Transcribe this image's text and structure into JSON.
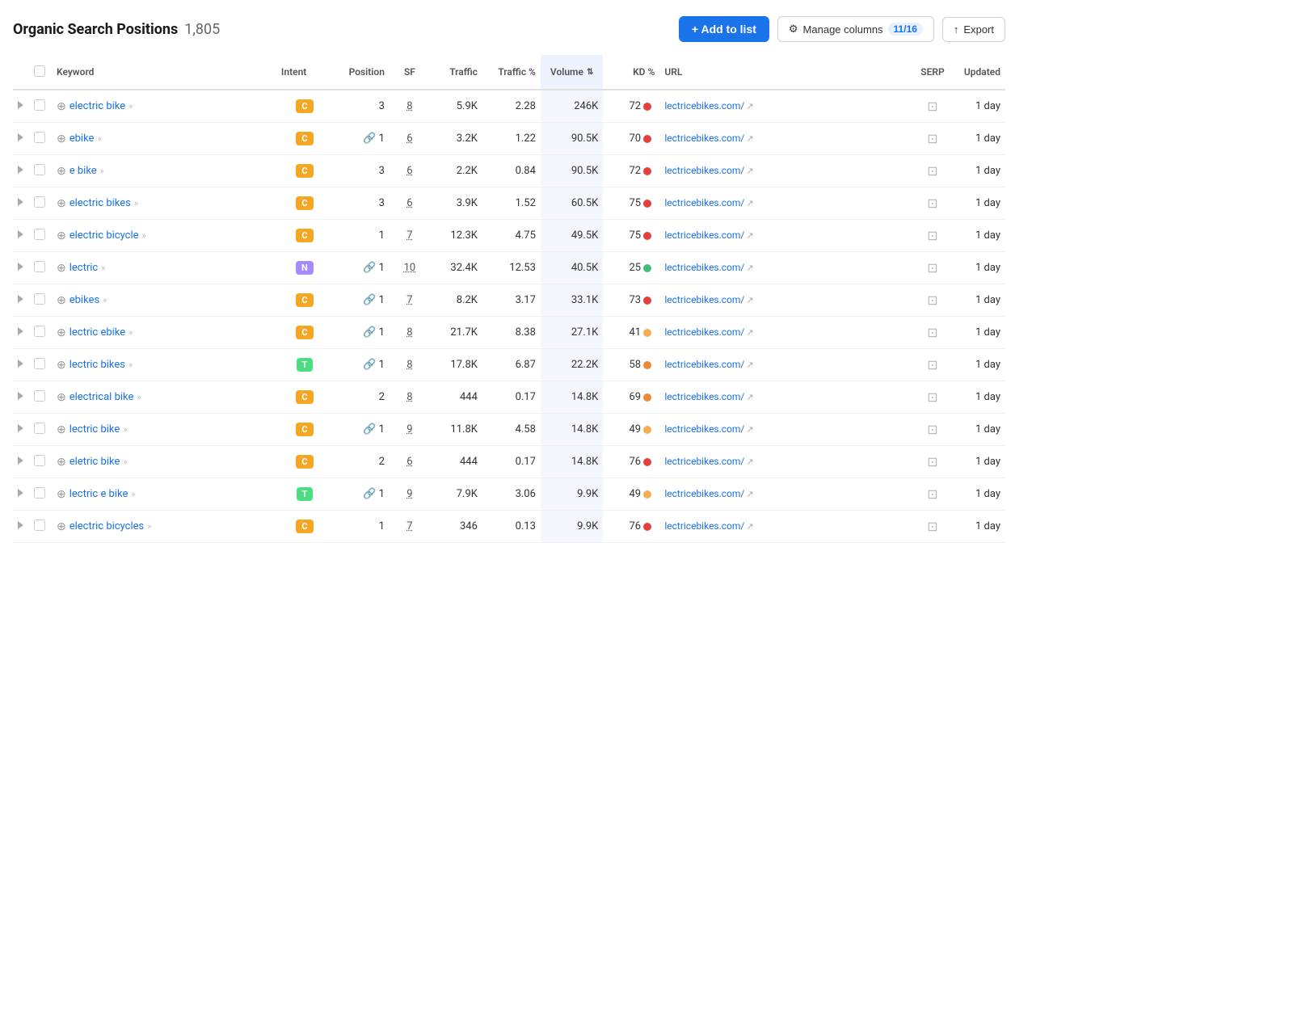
{
  "header": {
    "title": "Organic Search Positions",
    "count": "1,805",
    "add_button": "+ Add to list",
    "manage_columns_button": "Manage columns",
    "manage_columns_count": "11/16",
    "export_button": "Export"
  },
  "table": {
    "columns": [
      {
        "id": "expand",
        "label": ""
      },
      {
        "id": "check",
        "label": ""
      },
      {
        "id": "keyword",
        "label": "Keyword"
      },
      {
        "id": "intent",
        "label": "Intent"
      },
      {
        "id": "position",
        "label": "Position"
      },
      {
        "id": "sf",
        "label": "SF"
      },
      {
        "id": "traffic",
        "label": "Traffic"
      },
      {
        "id": "traffic_pct",
        "label": "Traffic %"
      },
      {
        "id": "volume",
        "label": "Volume"
      },
      {
        "id": "kd",
        "label": "KD %"
      },
      {
        "id": "url",
        "label": "URL"
      },
      {
        "id": "serp",
        "label": "SERP"
      },
      {
        "id": "updated",
        "label": "Updated"
      }
    ],
    "rows": [
      {
        "keyword": "electric bike",
        "intent": "C",
        "intent_type": "c",
        "has_link": false,
        "position": "3",
        "sf": "8",
        "traffic": "5.9K",
        "traffic_pct": "2.28",
        "volume": "246K",
        "kd": "72",
        "kd_color": "#e53e3e",
        "url": "lectricebikes.com/",
        "updated": "1 day"
      },
      {
        "keyword": "ebike",
        "intent": "C",
        "intent_type": "c",
        "has_link": true,
        "position": "1",
        "sf": "6",
        "traffic": "3.2K",
        "traffic_pct": "1.22",
        "volume": "90.5K",
        "kd": "70",
        "kd_color": "#e53e3e",
        "url": "lectricebikes.com/",
        "updated": "1 day"
      },
      {
        "keyword": "e bike",
        "intent": "C",
        "intent_type": "c",
        "has_link": false,
        "position": "3",
        "sf": "6",
        "traffic": "2.2K",
        "traffic_pct": "0.84",
        "volume": "90.5K",
        "kd": "72",
        "kd_color": "#e53e3e",
        "url": "lectricebikes.com/",
        "updated": "1 day"
      },
      {
        "keyword": "electric bikes",
        "intent": "C",
        "intent_type": "c",
        "has_link": false,
        "position": "3",
        "sf": "6",
        "traffic": "3.9K",
        "traffic_pct": "1.52",
        "volume": "60.5K",
        "kd": "75",
        "kd_color": "#e53e3e",
        "url": "lectricebikes.com/",
        "updated": "1 day"
      },
      {
        "keyword": "electric bicycle",
        "intent": "C",
        "intent_type": "c",
        "has_link": false,
        "position": "1",
        "sf": "7",
        "traffic": "12.3K",
        "traffic_pct": "4.75",
        "volume": "49.5K",
        "kd": "75",
        "kd_color": "#e53e3e",
        "url": "lectricebikes.com/",
        "updated": "1 day"
      },
      {
        "keyword": "lectric",
        "intent": "N",
        "intent_type": "n",
        "has_link": true,
        "position": "1",
        "sf": "10",
        "traffic": "32.4K",
        "traffic_pct": "12.53",
        "volume": "40.5K",
        "kd": "25",
        "kd_color": "#48bb78",
        "url": "lectricebikes.com/",
        "updated": "1 day"
      },
      {
        "keyword": "ebikes",
        "intent": "C",
        "intent_type": "c",
        "has_link": true,
        "position": "1",
        "sf": "7",
        "traffic": "8.2K",
        "traffic_pct": "3.17",
        "volume": "33.1K",
        "kd": "73",
        "kd_color": "#e53e3e",
        "url": "lectricebikes.com/",
        "updated": "1 day"
      },
      {
        "keyword": "lectric ebike",
        "intent": "C",
        "intent_type": "c",
        "has_link": true,
        "position": "1",
        "sf": "8",
        "traffic": "21.7K",
        "traffic_pct": "8.38",
        "volume": "27.1K",
        "kd": "41",
        "kd_color": "#f6ad55",
        "url": "lectricebikes.com/",
        "updated": "1 day"
      },
      {
        "keyword": "lectric bikes",
        "intent": "T",
        "intent_type": "t",
        "has_link": true,
        "position": "1",
        "sf": "8",
        "traffic": "17.8K",
        "traffic_pct": "6.87",
        "volume": "22.2K",
        "kd": "58",
        "kd_color": "#ed8936",
        "url": "lectricebikes.com/",
        "updated": "1 day"
      },
      {
        "keyword": "electrical bike",
        "intent": "C",
        "intent_type": "c",
        "has_link": false,
        "position": "2",
        "sf": "8",
        "traffic": "444",
        "traffic_pct": "0.17",
        "volume": "14.8K",
        "kd": "69",
        "kd_color": "#ed8936",
        "url": "lectricebikes.com/",
        "updated": "1 day"
      },
      {
        "keyword": "lectric bike",
        "intent": "C",
        "intent_type": "c",
        "has_link": true,
        "position": "1",
        "sf": "9",
        "traffic": "11.8K",
        "traffic_pct": "4.58",
        "volume": "14.8K",
        "kd": "49",
        "kd_color": "#f6ad55",
        "url": "lectricebikes.com/",
        "updated": "1 day"
      },
      {
        "keyword": "eletric bike",
        "intent": "C",
        "intent_type": "c",
        "has_link": false,
        "position": "2",
        "sf": "6",
        "traffic": "444",
        "traffic_pct": "0.17",
        "volume": "14.8K",
        "kd": "76",
        "kd_color": "#e53e3e",
        "url": "lectricebikes.com/",
        "updated": "1 day"
      },
      {
        "keyword": "lectric e bike",
        "intent": "T",
        "intent_type": "t",
        "has_link": true,
        "position": "1",
        "sf": "9",
        "traffic": "7.9K",
        "traffic_pct": "3.06",
        "volume": "9.9K",
        "kd": "49",
        "kd_color": "#f6ad55",
        "url": "lectricebikes.com/",
        "updated": "1 day"
      },
      {
        "keyword": "electric bicycles",
        "intent": "C",
        "intent_type": "c",
        "has_link": false,
        "position": "1",
        "sf": "7",
        "traffic": "346",
        "traffic_pct": "0.13",
        "volume": "9.9K",
        "kd": "76",
        "kd_color": "#e53e3e",
        "url": "lectricebikes.com/",
        "updated": "1 day"
      }
    ]
  }
}
